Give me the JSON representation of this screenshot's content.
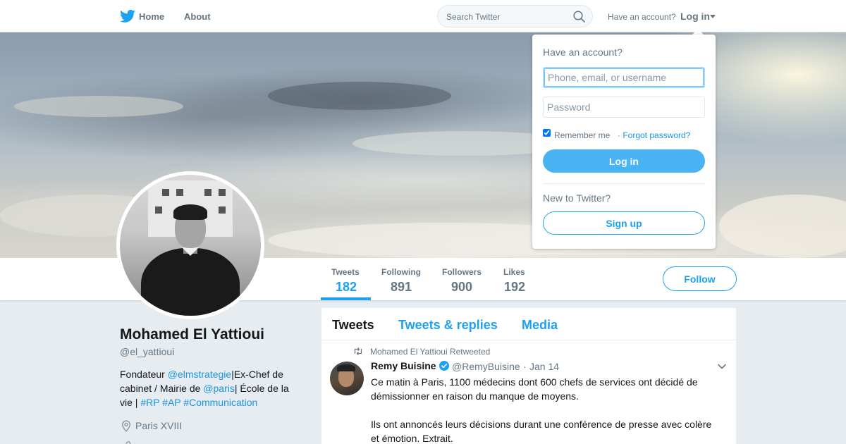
{
  "nav": {
    "logo_icon": "twitter-bird-icon",
    "home_label": "Home",
    "about_label": "About",
    "search_placeholder": "Search Twitter",
    "have_account": "Have an account?",
    "login_label": "Log in"
  },
  "profile": {
    "name": "Mohamed El Yattioui",
    "handle": "@el_yattioui",
    "bio": {
      "t1": "Fondateur ",
      "m1": "@elmstrategie",
      "t2": "|Ex-Chef de cabinet / Mairie de ",
      "m2": "@paris",
      "t3": "| École de la vie | ",
      "h1": "#RP",
      "h2": "#AP",
      "h3": "#Communication"
    },
    "location": "Paris XVIII"
  },
  "stats": {
    "tweets": {
      "label": "Tweets",
      "value": "182"
    },
    "following": {
      "label": "Following",
      "value": "891"
    },
    "followers": {
      "label": "Followers",
      "value": "900"
    },
    "likes": {
      "label": "Likes",
      "value": "192"
    },
    "follow_label": "Follow"
  },
  "timeline": {
    "tabs": [
      "Tweets",
      "Tweets & replies",
      "Media"
    ],
    "tweet": {
      "retweet_notice": "Mohamed El Yattioui Retweeted",
      "author": "Remy Buisine",
      "handle": "@RemyBuisine",
      "separator": "·",
      "date": "Jan 14",
      "paragraph1": "Ce matin à Paris, 1100 médecins dont 600 chefs de services ont décidé de démissionner en raison du manque de moyens.",
      "paragraph2": "Ils ont annoncés leurs décisions durant une conférence de presse avec colère et émotion. Extrait."
    }
  },
  "login_dropdown": {
    "title": "Have an account?",
    "username_placeholder": "Phone, email, or username",
    "password_placeholder": "Password",
    "remember_label": "Remember me",
    "forgot_label": "· Forgot password?",
    "login_button": "Log in",
    "new_label": "New to Twitter?",
    "signup_button": "Sign up"
  },
  "colors": {
    "accent": "#1da1f2",
    "login_button": "#4ab3f4",
    "background": "#e6ecf0"
  }
}
